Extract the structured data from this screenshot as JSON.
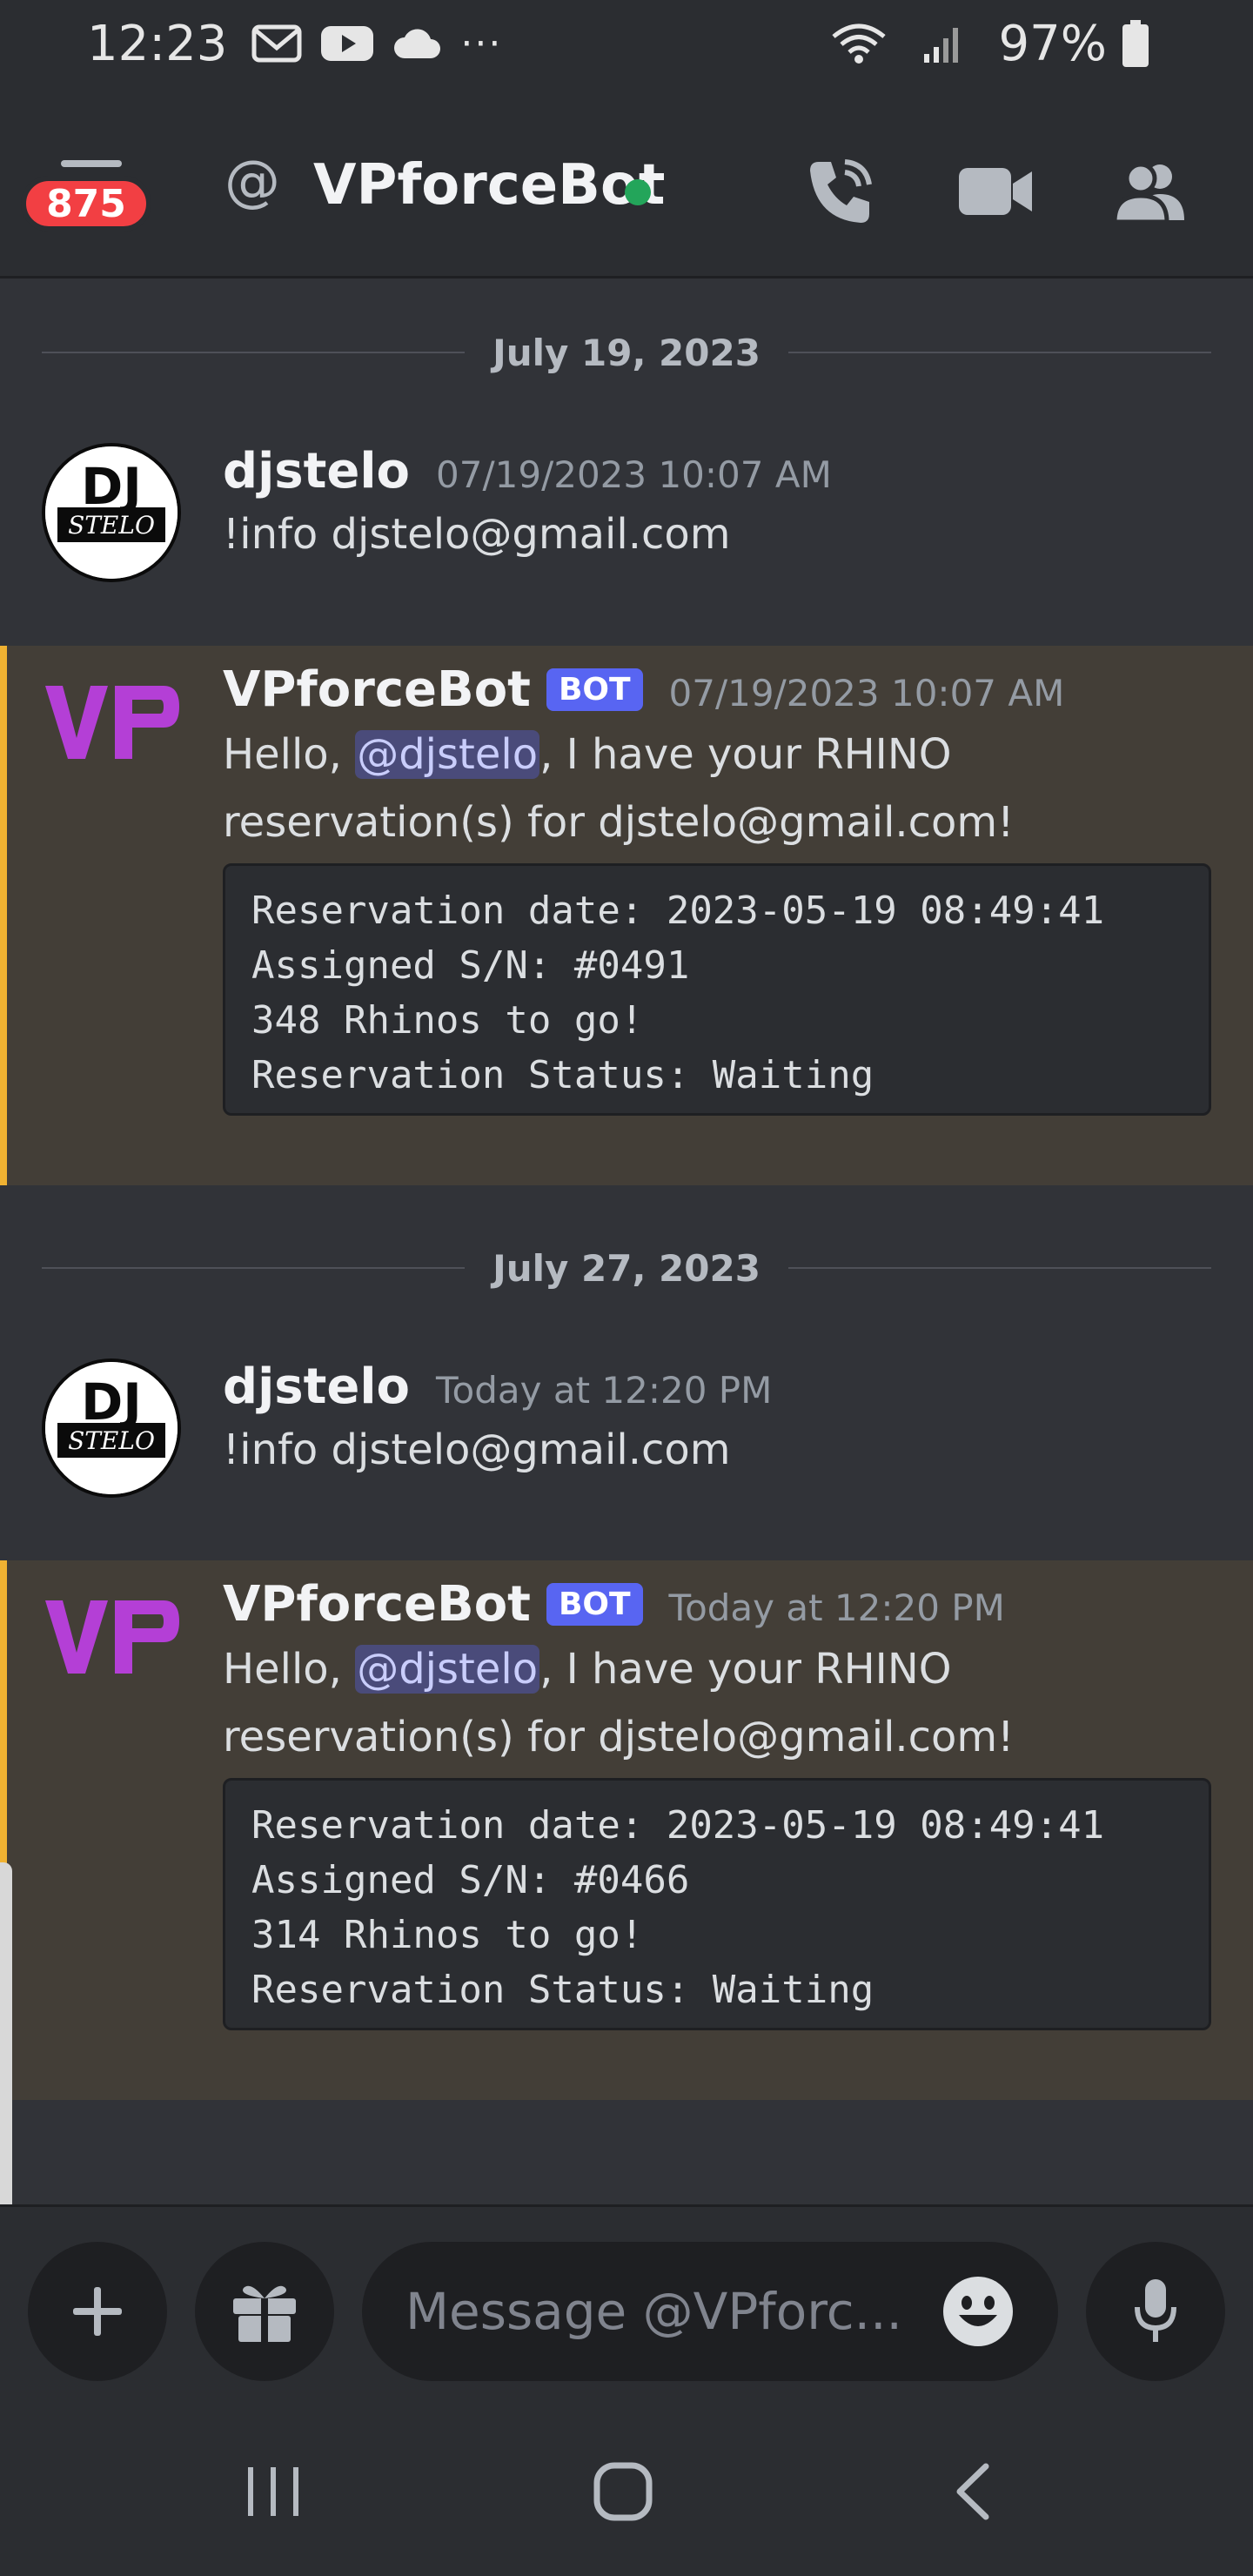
{
  "status_bar": {
    "time": "12:23",
    "battery": "97%",
    "more": "···"
  },
  "header": {
    "unread_badge": "875",
    "channel_name": "VPforceBot",
    "at_symbol": "@"
  },
  "messages": [
    {
      "type": "date_divider",
      "date": "July 19, 2023"
    },
    {
      "type": "message",
      "author": "djstelo",
      "timestamp": "07/19/2023 10:07 AM",
      "text": "!info djstelo@gmail.com",
      "avatar_text": "STELO"
    },
    {
      "type": "bot_message",
      "author": "VPforceBot",
      "tag": "BOT",
      "timestamp": "07/19/2023 10:07 AM",
      "text_before": "Hello, ",
      "mention": "@djstelo",
      "text_after": ", I have your RHINO reservation(s) for djstelo@gmail.com!",
      "code_lines": [
        "Reservation date: 2023-05-19 08:49:41",
        "Assigned S/N: #0491",
        "348 Rhinos to go!",
        "Reservation Status: Waiting"
      ]
    },
    {
      "type": "date_divider",
      "date": "July 27, 2023"
    },
    {
      "type": "message",
      "author": "djstelo",
      "timestamp": "Today at 12:20 PM",
      "text": "!info djstelo@gmail.com",
      "avatar_text": "STELO"
    },
    {
      "type": "bot_message",
      "author": "VPforceBot",
      "tag": "BOT",
      "timestamp": "Today at 12:20 PM",
      "text_before": "Hello, ",
      "mention": "@djstelo",
      "text_after": ", I have your RHINO reservation(s) for djstelo@gmail.com!",
      "code_lines": [
        "Reservation date: 2023-05-19 08:49:41",
        "Assigned S/N: #0466",
        "314 Rhinos to go!",
        "Reservation Status: Waiting"
      ]
    }
  ],
  "composer": {
    "placeholder": "Message @VPforc..."
  },
  "colors": {
    "background": "#313338",
    "bar": "#2b2d31",
    "highlight": "#433e37",
    "highlight_border": "#f0b232",
    "mention_bg": "#4a4b7a",
    "bot_tag": "#5865f2",
    "online": "#23a55a",
    "badge": "#f23f43",
    "bot_logo": "#b43fd6"
  },
  "icons": {
    "status_left": [
      "gmail-icon",
      "youtube-icon",
      "cloud-icon"
    ],
    "status_right": [
      "wifi-icon",
      "signal-icon",
      "battery-icon"
    ],
    "header_actions": [
      "phone-call-icon",
      "video-camera-icon",
      "members-icon"
    ],
    "composer": [
      "plus-icon",
      "gift-icon",
      "emoji-icon",
      "microphone-icon"
    ],
    "nav": [
      "recent-apps-icon",
      "home-icon",
      "back-icon"
    ]
  }
}
